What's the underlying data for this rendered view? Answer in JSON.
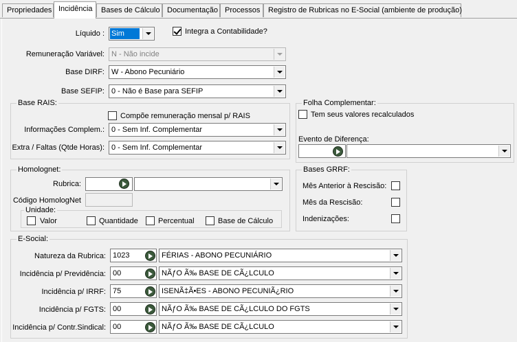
{
  "tabs": [
    {
      "label": "Propriedades"
    },
    {
      "label": "Incidência"
    },
    {
      "label": "Bases de Cálculo"
    },
    {
      "label": "Documentação"
    },
    {
      "label": "Processos"
    },
    {
      "label": "Registro de Rubricas no E-Social (ambiente de produção)"
    }
  ],
  "general": {
    "liquido_label": "Líquido :",
    "liquido_value": "Sim",
    "integra_label": "Integra a Contabilidade?",
    "integra_checked": true,
    "rem_variavel_label": "Remuneração Variável:",
    "rem_variavel_value": "N - Não incide",
    "base_dirf_label": "Base DIRF:",
    "base_dirf_value": "W - Abono Pecuniário",
    "base_sefip_label": "Base SEFIP:",
    "base_sefip_value": "0 - Não é Base para SEFIP"
  },
  "rais": {
    "title": "Base RAIS:",
    "compoe_label": "Compõe remuneração mensal p/ RAIS",
    "info_label": "Informações Complem.:",
    "info_value": "0 - Sem Inf. Complementar",
    "extra_label": "Extra / Faltas (Qtde Horas):",
    "extra_value": "0 - Sem Inf. Complementar"
  },
  "folha": {
    "title": "Folha Complementar:",
    "recalc_label": "Tem seus valores recalculados",
    "evento_label": "Evento de Diferença:",
    "evento_code": "",
    "evento_value": ""
  },
  "homolognet": {
    "title": "Homolognet:",
    "rubrica_label": "Rubrica:",
    "rubrica_code": "",
    "rubrica_value": "",
    "codigo_label": "Código HomologNet",
    "codigo_value": "",
    "unidade_title": "Unidade:",
    "unidades": [
      "Valor",
      "Quantidade",
      "Percentual",
      "Base de Cálculo"
    ]
  },
  "grrf": {
    "title": "Bases GRRF:",
    "items": [
      "Mês Anterior à Rescisão:",
      "Mês da Rescisão:",
      "Indenizações:"
    ]
  },
  "esocial": {
    "title": "E-Social:",
    "rows": [
      {
        "label": "Natureza da Rubrica:",
        "code": "1023",
        "value": "FÉRIAS - ABONO PECUNIÁRIO"
      },
      {
        "label": "Incidência p/ Previdência:",
        "code": "00",
        "value": "NÃƒO Ã‰ BASE DE CÃ¿LCULO"
      },
      {
        "label": "Incidência p/ IRRF:",
        "code": "75",
        "value": "ISENÃ‡Ã•ES - ABONO PECUNIÃ¿RIO"
      },
      {
        "label": "Incidência p/ FGTS:",
        "code": "00",
        "value": "NÃƒO Ã‰ BASE DE CÃ¿LCULO DO FGTS"
      },
      {
        "label": "Incidência p/ Contr.Sindical:",
        "code": "00",
        "value": "NÃƒO Ã‰ BASE DE CÃ¿LCULO"
      }
    ]
  },
  "colors": {
    "selection": "#0078d7",
    "panel": "#f0f0f0",
    "border": "#7a7a7a"
  },
  "icons": {
    "search": "search-go-icon",
    "dropdown": "chevron-down-icon",
    "check": "checkmark-icon"
  }
}
